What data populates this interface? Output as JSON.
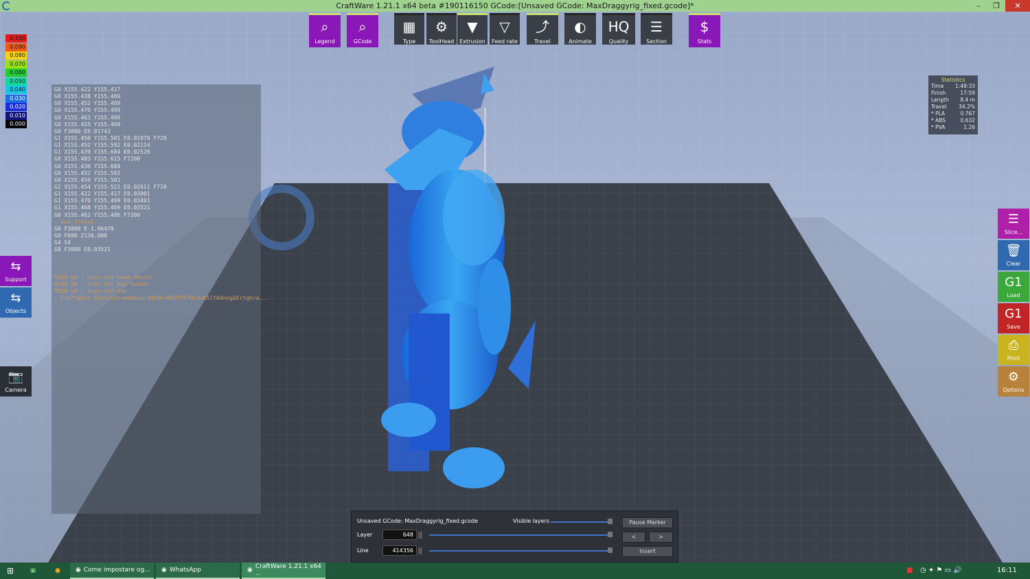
{
  "window": {
    "title": "CraftWare 1.21.1 x64 beta #190116150  GCode:[Unsaved GCode: MaxDraggyrig_fixed.gcode]*"
  },
  "window_controls": {
    "minimize": "–",
    "maximize": "❐",
    "close": "✕"
  },
  "toolbar": [
    {
      "label": "Legend",
      "icon": "magnifier-list-icon",
      "glyph": "⌕",
      "style": "purple"
    },
    {
      "label": "GCode",
      "icon": "gcode-magnifier-icon",
      "glyph": "⌕",
      "style": "purple"
    },
    {
      "label": "Type",
      "icon": "layer-type-icon",
      "glyph": "▦",
      "style": "dark"
    },
    {
      "label": "ToolHead",
      "icon": "toolhead-icon",
      "glyph": "⚙",
      "style": "dark"
    },
    {
      "label": "Extrusion",
      "icon": "extrusion-nozzle-icon",
      "glyph": "▼",
      "style": "dark sel"
    },
    {
      "label": "Feed rate",
      "icon": "feedrate-nozzle-icon",
      "glyph": "▽",
      "style": "dark"
    },
    {
      "label": "Travel",
      "icon": "travel-path-icon",
      "glyph": "⤴",
      "style": "dark sel"
    },
    {
      "label": "Animate",
      "icon": "animate-icon",
      "glyph": "◐",
      "style": "dark"
    },
    {
      "label": "Quality",
      "icon": "hq-quality-icon",
      "glyph": "HQ",
      "style": "dark"
    },
    {
      "label": "Section",
      "icon": "section-icon",
      "glyph": "☰",
      "style": "dark"
    },
    {
      "label": "Stats",
      "icon": "stats-magnifier-icon",
      "glyph": "$",
      "style": "purple"
    }
  ],
  "legend_scale": [
    {
      "value": "0.100",
      "color": "#e01b1b"
    },
    {
      "value": "0.090",
      "color": "#f05a18"
    },
    {
      "value": "0.080",
      "color": "#f4d21a"
    },
    {
      "value": "0.070",
      "color": "#9ae01a"
    },
    {
      "value": "0.060",
      "color": "#22cc33"
    },
    {
      "value": "0.050",
      "color": "#16d9a0"
    },
    {
      "value": "0.040",
      "color": "#19c6e6"
    },
    {
      "value": "0.030",
      "color": "#1a6ee0"
    },
    {
      "value": "0.020",
      "color": "#1b2fd8"
    },
    {
      "value": "0.010",
      "color": "#13137a"
    },
    {
      "value": "0.000",
      "color": "#050505"
    }
  ],
  "gcode_lines": [
    {
      "text": "G0 X155.422 Y155.417",
      "comment": false
    },
    {
      "text": "G0 X155.438 Y155.469",
      "comment": false
    },
    {
      "text": "G0 X155.452 Y155.469",
      "comment": false
    },
    {
      "text": "G0 X155.470 Y155.499",
      "comment": false
    },
    {
      "text": "G0 X155.463 Y155.409",
      "comment": false
    },
    {
      "text": "G0 X155.455 Y155.469",
      "comment": false
    },
    {
      "text": "G0 F3000 E0.01743",
      "comment": false
    },
    {
      "text": "G1 X155.450 Y155.501 E0.01870 F720",
      "comment": false
    },
    {
      "text": "G1 X155.452 Y155.592 E0.02214",
      "comment": false
    },
    {
      "text": "G1 X155.439 Y155.684 E0.02526",
      "comment": false
    },
    {
      "text": "G0 X155.483 Y155.615 F7200",
      "comment": false
    },
    {
      "text": "G0 X155.439 Y155.684",
      "comment": false
    },
    {
      "text": "G0 X155.452 Y155.592",
      "comment": false
    },
    {
      "text": "G0 X155.450 Y155.501",
      "comment": false
    },
    {
      "text": "G1 X155.454 Y155.521 E0.02611 F720",
      "comment": false
    },
    {
      "text": "G1 X155.422 Y155.417 E0.03001",
      "comment": false
    },
    {
      "text": "G1 X155.470 Y155.499 E0.03401",
      "comment": false
    },
    {
      "text": "G1 X155.468 Y155.469 E0.03521",
      "comment": false
    },
    {
      "text": "G0 X155.462 Y155.486 F7200",
      "comment": false
    },
    {
      "text": "; end_travel",
      "comment": true
    },
    {
      "text": "G0 F3000 E-1.96479",
      "comment": false
    },
    {
      "text": "G0 F600 Z130.000",
      "comment": false
    },
    {
      "text": "G4 S4",
      "comment": false
    },
    {
      "text": "G0 F3000 E0.03521",
      "comment": false
    },
    {
      "text": "",
      "comment": false
    },
    {
      "text": "",
      "comment": false
    },
    {
      "text": "",
      "comment": false
    },
    {
      "text": "M104 S0 ; turn off head heater",
      "comment": true
    },
    {
      "text": "M140 S0 ; turn off bed heater",
      "comment": true
    },
    {
      "text": "M106 S0 ; turn off fan",
      "comment": true
    },
    {
      "text": "; CraftWare_Settings=AAAGunjaNhRb+MEH7fX7Hs3vKSlYA4nngbErtghra...",
      "comment": true
    }
  ],
  "left_buttons": [
    {
      "label": "Support",
      "icon": "support-icon",
      "glyph": "⇆"
    },
    {
      "label": "Objects",
      "icon": "objects-icon",
      "glyph": "⇆"
    },
    {
      "label": "Camera",
      "icon": "camera-icon",
      "glyph": "📷"
    }
  ],
  "right_buttons": [
    {
      "label": "Slice...",
      "icon": "slice-icon",
      "glyph": "☰",
      "color": "#b01fa8"
    },
    {
      "label": "Clear",
      "icon": "clear-trash-icon",
      "glyph": "🗑",
      "color": "#2f6ab0"
    },
    {
      "label": "Load",
      "icon": "load-gcode-icon",
      "glyph": "G1",
      "color": "#3aa83a"
    },
    {
      "label": "Save",
      "icon": "save-gcode-icon",
      "glyph": "G1",
      "color": "#c12525"
    },
    {
      "label": "Print",
      "icon": "print-icon",
      "glyph": "⎙",
      "color": "#c9b41f"
    },
    {
      "label": "Options",
      "icon": "gear-icon",
      "glyph": "⚙",
      "color": "#b9823b"
    }
  ],
  "stats": {
    "title": "Statistics",
    "rows": [
      {
        "k": "Time",
        "v": "1:48:33"
      },
      {
        "k": "Finish",
        "v": "17:59"
      },
      {
        "k": "Length",
        "v": "8.4 m"
      },
      {
        "k": "Travel",
        "v": "34.2%"
      },
      {
        "k": "* PLA",
        "v": "0.767"
      },
      {
        "k": "* ABS",
        "v": "0.632"
      },
      {
        "k": "* PVA",
        "v": "1.26"
      }
    ]
  },
  "bottom": {
    "filename": "Unsaved GCode: MaxDraggyrig_fixed.gcode",
    "visible_layers": "Visible layers",
    "layer_label": "Layer",
    "layer_value": "648",
    "line_label": "Line",
    "line_value": "414356",
    "pause_marker": "Pause Marker",
    "prev": "<",
    "next": ">",
    "insert": "Insert"
  },
  "taskbar": {
    "start_icon": "windows-start-icon",
    "pinned": [
      {
        "icon": "excel-icon",
        "glyph": "▣"
      },
      {
        "icon": "firefox-icon",
        "glyph": "●"
      }
    ],
    "apps": [
      {
        "label": "Come impostare og...",
        "icon": "chrome-icon",
        "active": false
      },
      {
        "label": "WhatsApp",
        "icon": "whatsapp-icon",
        "active": false
      },
      {
        "label": "CraftWare 1.21.1 x64 ...",
        "icon": "craftware-icon",
        "active": true
      }
    ],
    "clock": "16:11"
  }
}
